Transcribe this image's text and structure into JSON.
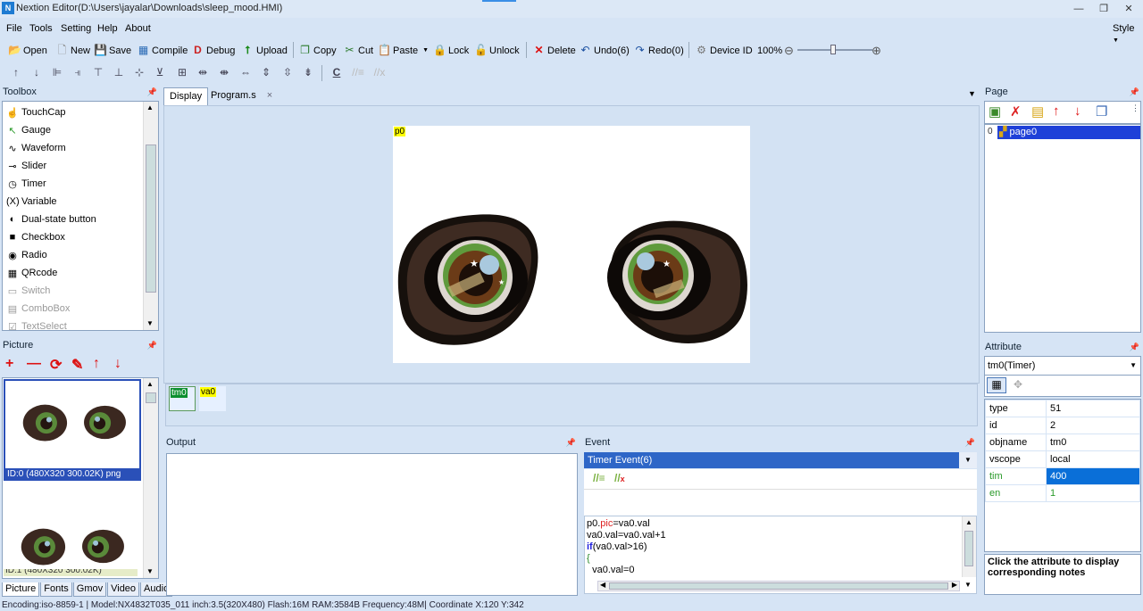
{
  "window": {
    "title": "Nextion Editor(D:\\Users\\jayalar\\Downloads\\sleep_mood.HMI)",
    "logo": "N"
  },
  "menu": {
    "items": [
      "File",
      "Tools",
      "Setting",
      "Help",
      "About"
    ],
    "style": "Style"
  },
  "toolbar": {
    "open": "Open",
    "new": "New",
    "save": "Save",
    "compile": "Compile",
    "debug": "Debug",
    "upload": "Upload",
    "copy": "Copy",
    "cut": "Cut",
    "paste": "Paste",
    "lock": "Lock",
    "unlock": "Unlock",
    "delete": "Delete",
    "undo": "Undo(6)",
    "redo": "Redo(0)",
    "device_id": "Device ID",
    "zoom": "100%"
  },
  "toolbox": {
    "title": "Toolbox",
    "items": [
      {
        "label": "TouchCap",
        "icon": "touch-icon",
        "glyph": "☝"
      },
      {
        "label": "Gauge",
        "icon": "gauge-icon",
        "glyph": "↖"
      },
      {
        "label": "Waveform",
        "icon": "waveform-icon",
        "glyph": "∿"
      },
      {
        "label": "Slider",
        "icon": "slider-icon",
        "glyph": "⊸"
      },
      {
        "label": "Timer",
        "icon": "timer-icon",
        "glyph": "◷"
      },
      {
        "label": "Variable",
        "icon": "variable-icon",
        "glyph": "(X)"
      },
      {
        "label": "Dual-state button",
        "icon": "dual-state-icon",
        "glyph": "◐"
      },
      {
        "label": "Checkbox",
        "icon": "checkbox-icon",
        "glyph": "■"
      },
      {
        "label": "Radio",
        "icon": "radio-icon",
        "glyph": "◉"
      },
      {
        "label": "QRcode",
        "icon": "qrcode-icon",
        "glyph": "▦"
      },
      {
        "label": "Switch",
        "icon": "switch-icon",
        "glyph": "▭"
      },
      {
        "label": "ComboBox",
        "icon": "combobox-icon",
        "glyph": "▤"
      },
      {
        "label": "TextSelect",
        "icon": "textselect-icon",
        "glyph": "☑"
      }
    ]
  },
  "picture": {
    "title": "Picture",
    "item0": "ID:0  (480X320 300.02K) png",
    "item1": "ID:1  (480X320 300.02K)"
  },
  "bottom_tabs": [
    "Picture",
    "Fonts",
    "Gmov",
    "Video",
    "Audio"
  ],
  "doc_tabs": {
    "display": "Display",
    "program": "Program.s",
    "close": "×"
  },
  "canvas": {
    "page_label": "p0"
  },
  "objects": {
    "tm0": "tm0",
    "va0": "va0"
  },
  "output": {
    "title": "Output"
  },
  "event": {
    "title": "Event",
    "dropdown": "Timer Event(6)",
    "code": [
      "p0.pic=va0.val",
      "va0.val=va0.val+1",
      "if(va0.val>16)",
      "{",
      "  va0.val=0"
    ]
  },
  "page_panel": {
    "title": "Page",
    "index": "0",
    "page_name": "page0"
  },
  "attribute": {
    "title": "Attribute",
    "selector": "tm0(Timer)",
    "rows": [
      {
        "name": "type",
        "value": "51"
      },
      {
        "name": "id",
        "value": "2"
      },
      {
        "name": "objname",
        "value": "tm0"
      },
      {
        "name": "vscope",
        "value": "local"
      },
      {
        "name": "tim",
        "value": "400"
      },
      {
        "name": "en",
        "value": "1"
      }
    ],
    "note": "Click the attribute to display corresponding notes"
  },
  "status": {
    "text": "Encoding:iso-8859-1 | Model:NX4832T035_011 inch:3.5(320X480) Flash:16M RAM:3584B Frequency:48M|    Coordinate X:120  Y:342"
  }
}
